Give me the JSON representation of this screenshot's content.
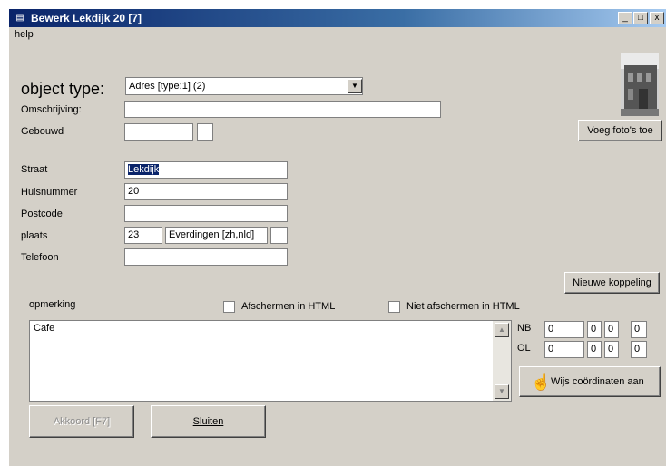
{
  "window": {
    "title": "Bewerk Lekdijk 20 [7]",
    "minimize_label": "_",
    "maximize_label": "□",
    "close_label": "x"
  },
  "menu": {
    "help": "help"
  },
  "form": {
    "object_type_label": "object type:",
    "object_type_value": "Adres [type:1] (2)",
    "omschrijving_label": "Omschrijving:",
    "omschrijving_value": "",
    "gebouwd_label": "Gebouwd",
    "gebouwd_value": "",
    "straat_label": "Straat",
    "straat_value": "Lekdijk",
    "huisnummer_label": "Huisnummer",
    "huisnummer_value": "20",
    "postcode_label": "Postcode",
    "postcode_value": "",
    "plaats_label": "plaats",
    "plaats_code": "23",
    "plaats_name": "Everdingen [zh,nld]",
    "telefoon_label": "Telefoon",
    "telefoon_value": ""
  },
  "buttons": {
    "voeg_foto": "Voeg foto's toe",
    "nieuwe_koppeling": "Nieuwe koppeling",
    "wijs_coordinaten": "Wijs coördinaten aan",
    "akkoord": "Akkoord [F7]",
    "sluiten": "Sluiten"
  },
  "remarks": {
    "label": "opmerking",
    "afschermen_label": "Afschermen in HTML",
    "niet_afschermen_label": "Niet afschermen in HTML",
    "text": "Cafe"
  },
  "coords": {
    "nb_label": "NB",
    "ol_label": "OL",
    "nb": [
      "0",
      "0",
      "0",
      "0"
    ],
    "ol": [
      "0",
      "0",
      "0",
      "0"
    ]
  }
}
